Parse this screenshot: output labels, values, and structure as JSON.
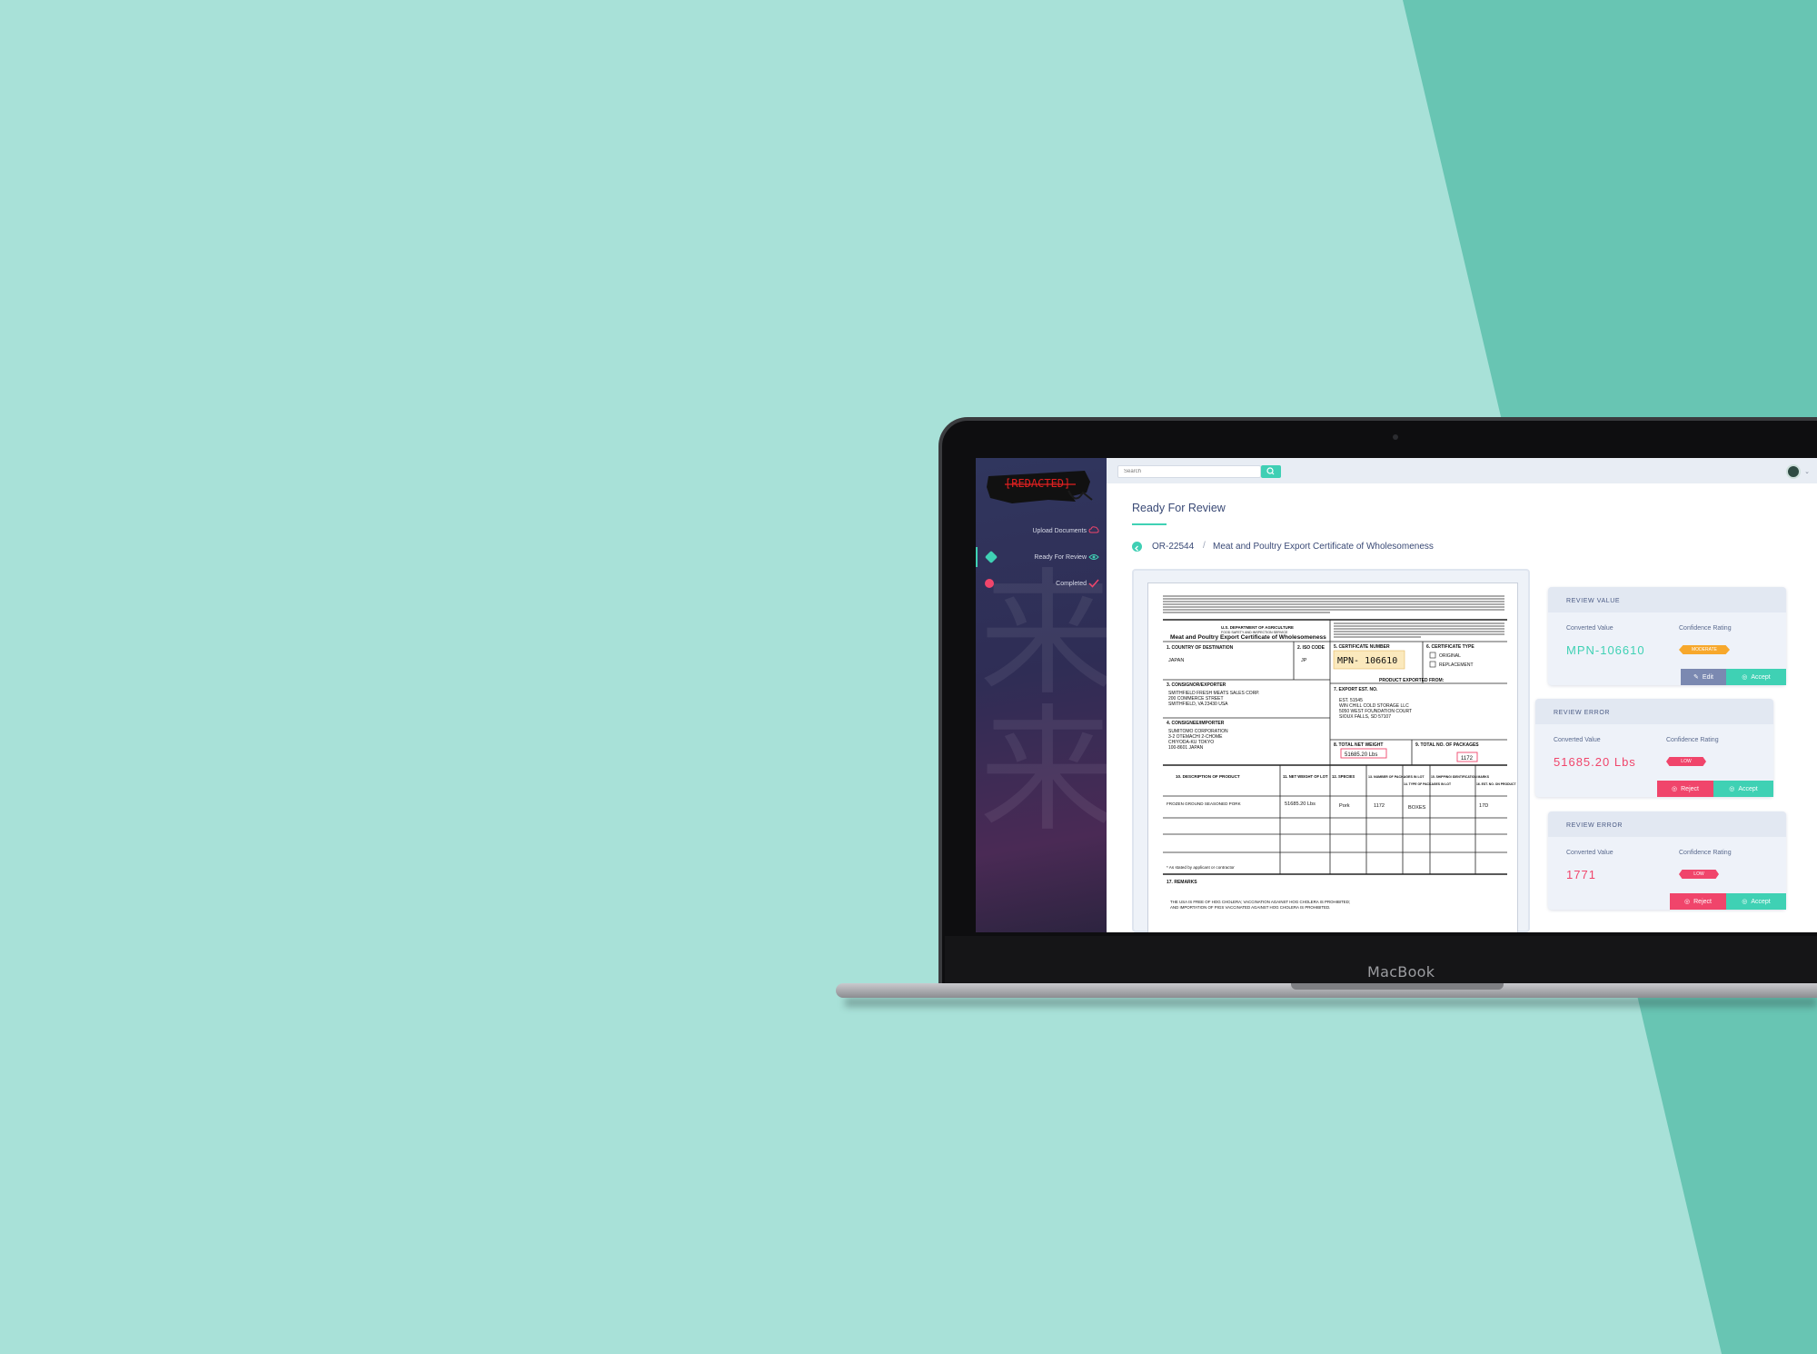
{
  "colors": {
    "background": "#a8e1d8",
    "stripe": "#68c5b3",
    "accent": "#3fd1b4",
    "error": "#f0456b",
    "moderate": "#f7a82c",
    "navy_text": "#3a4a76"
  },
  "laptop": {
    "brand": "MacBook"
  },
  "sidebar": {
    "logo_text": "[REDACTED]",
    "items": [
      {
        "label": "Upload Documents",
        "icon": "cloud-upload-icon"
      },
      {
        "label": "Ready For Review",
        "icon": "eye-icon",
        "active": true
      },
      {
        "label": "Completed",
        "icon": "check-icon"
      }
    ]
  },
  "topbar": {
    "search_placeholder": "Search"
  },
  "page": {
    "title": "Ready For Review",
    "breadcrumb": {
      "id": "OR-22544",
      "separator": "/",
      "doc": "Meat and Poultry Export Certificate of Wholesomeness"
    }
  },
  "document": {
    "title": "Meat and Poultry Export Certificate of Wholesomeness",
    "agency": "U.S. DEPARTMENT OF AGRICULTURE",
    "service": "FOOD SAFETY AND INSPECTION SERVICE",
    "f1": "1. COUNTRY OF DESTINATION",
    "f1v": "JAPAN",
    "f2": "2. ISO CODE",
    "f2v": "JP",
    "f3": "3. CONSIGNOR/EXPORTER",
    "f3v": [
      "SMITHFIELD FRESH MEATS SALES CORP.",
      "200 COMMERCE STREET",
      "SMITHFIELD, VA 23430 USA"
    ],
    "f4": "4. CONSIGNEE/IMPORTER",
    "f4v": [
      "SUMITOMO CORPORATION",
      "3-2 OTEMACHI 2-CHOME",
      "CHIYODA-KU TOKYO",
      "100-8601 JAPAN"
    ],
    "f5": "5. CERTIFICATE NUMBER",
    "f5v": "MPN- 106610",
    "f6": "6. CERTIFICATE TYPE",
    "f6a": "ORIGINAL",
    "f6b": "REPLACEMENT",
    "export_from": "PRODUCT EXPORTED FROM:",
    "f7": "7. EXPORT EST. NO.",
    "f7v": [
      "EST. 51545",
      "WIN CHILL COLD STORAGE LLC",
      "5050 WEST FOUNDATION COURT",
      "SIOUX FALLS, SD 57107"
    ],
    "f8": "8. TOTAL NET WEIGHT",
    "f8v": "51685.20   Lbs",
    "f9": "9. TOTAL NO. OF PACKAGES",
    "f9v": "1172",
    "cols": [
      "10. DESCRIPTION OF PRODUCT",
      "11. NET WEIGHT OF LOT",
      "12. SPECIES",
      "13. NUMBER OF PACKAGES IN LOT",
      "14. TYPE OF PACKAGES IN LOT",
      "15. SHIPPING/ IDENTIFICATION MARKS",
      "16. EST. NO. ON PRODUCT"
    ],
    "row": [
      "FROZEN GROUND SEASONED PORK",
      "51685.20   Lbs",
      "Pork",
      "1172",
      "BOXES",
      "",
      "17D"
    ],
    "note": "* As stated by applicant or contractor",
    "remarks": "17.  REMARKS",
    "remarks_text": [
      "THE USA IS FREE OF HOG CHOLERA; VACCINATION AGAINST HOG CHOLERA IS PROHIBITED;",
      "AND IMPORTATION OF PIGS VACCINATED AGAINST HOG CHOLERA IS PROHIBITED."
    ]
  },
  "cards": [
    {
      "header": "REVIEW VALUE",
      "converted_label": "Converted Value",
      "value": "MPN-106610",
      "rating_label": "Confidence Rating",
      "rating": "MODERATE",
      "buttons": [
        "Edit",
        "Accept"
      ]
    },
    {
      "header": "REVIEW ERROR",
      "converted_label": "Converted Value",
      "value": "51685.20 Lbs",
      "rating_label": "Confidence Rating",
      "rating": "LOW",
      "buttons": [
        "Reject",
        "Accept"
      ]
    },
    {
      "header": "REVIEW ERROR",
      "converted_label": "Converted Value",
      "value": "1771",
      "rating_label": "Confidence Rating",
      "rating": "LOW",
      "buttons": [
        "Reject",
        "Accept"
      ]
    }
  ]
}
